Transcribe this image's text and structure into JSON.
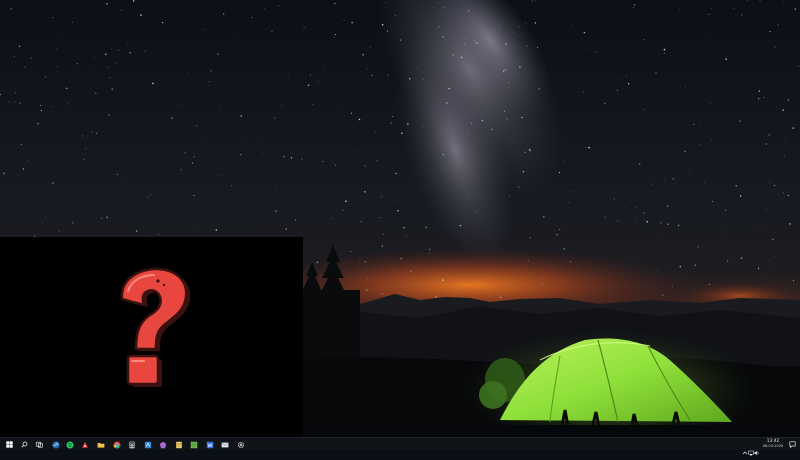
{
  "wallpaper": {
    "description_icon": "night-sky-tent-wallpaper",
    "colors": {
      "sky_top": "#0c1118",
      "sky_mid": "#1a1d24",
      "horizon_glow": "#d9621f",
      "tent": "#8ee33b"
    }
  },
  "preview_window": {
    "icon": "question-mark-icon",
    "colors": {
      "background": "#000000",
      "mark_fill": "#e8473f",
      "mark_outline": "#3a1210"
    }
  },
  "taskbar": {
    "colors": {
      "background": "#101418"
    },
    "apps": [
      {
        "name": "start",
        "icon": "windows-start-icon",
        "color": "#ffffff"
      },
      {
        "name": "search",
        "icon": "search-icon",
        "color": "#ffffff"
      },
      {
        "name": "task-view",
        "icon": "task-view-icon",
        "color": "#ffffff"
      },
      {
        "name": "steam",
        "icon": "steam-icon",
        "color": "#1f6fb5"
      },
      {
        "name": "spotify",
        "icon": "spotify-icon",
        "color": "#1ed760"
      },
      {
        "name": "app-red",
        "icon": "red-app-icon",
        "color": "#e03a3a"
      },
      {
        "name": "file-explorer",
        "icon": "folder-icon",
        "color": "#f2c14e"
      },
      {
        "name": "chrome",
        "icon": "chrome-icon",
        "color": "#f3b51b"
      },
      {
        "name": "calculator",
        "icon": "calculator-icon",
        "color": "#bfbfbf"
      },
      {
        "name": "app-blue",
        "icon": "blue-app-icon",
        "color": "#2c86d6"
      },
      {
        "name": "app-purple",
        "icon": "purple-app-icon",
        "color": "#a86bd6"
      },
      {
        "name": "notes",
        "icon": "notes-icon",
        "color": "#f3d36b"
      },
      {
        "name": "spreadsheet",
        "icon": "spreadsheet-icon",
        "color": "#7cc45a"
      },
      {
        "name": "word",
        "icon": "word-icon",
        "color": "#2d6fd8"
      },
      {
        "name": "mail",
        "icon": "mail-icon",
        "color": "#dfe6f0"
      },
      {
        "name": "settings",
        "icon": "gear-icon",
        "color": "#e0e0e0"
      }
    ],
    "tray": {
      "icons": [
        "chevron-up-icon",
        "network-icon",
        "volume-icon"
      ],
      "time": "13:42",
      "date": "06.03.2020",
      "notification_icon": "notification-icon"
    }
  }
}
